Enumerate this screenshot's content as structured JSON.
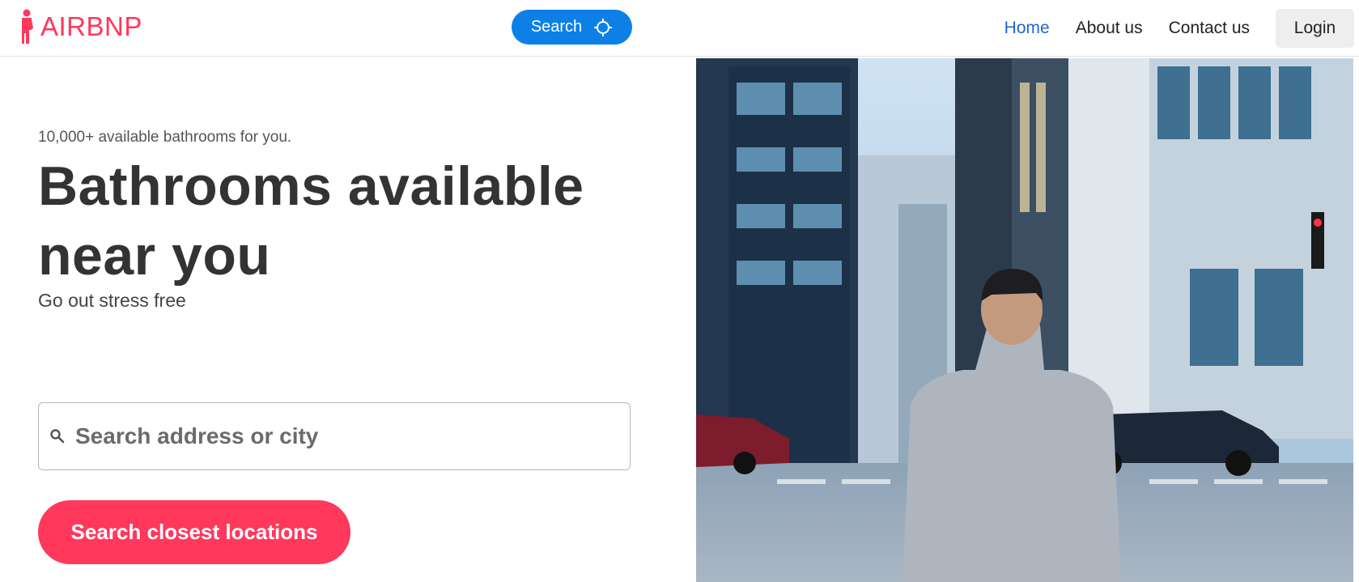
{
  "brand": {
    "name": "AIRBNP",
    "accent": "#ff385c"
  },
  "nav": {
    "search_label": "Search",
    "links": [
      {
        "label": "Home",
        "active": true
      },
      {
        "label": "About us",
        "active": false
      },
      {
        "label": "Contact us",
        "active": false
      }
    ],
    "login_label": "Login",
    "search_color": "#0d80e8"
  },
  "hero": {
    "tagline": "10,000+ available bathrooms for you.",
    "headline": "Bathrooms available near you",
    "subline": "Go out stress free",
    "search_placeholder": "Search address or city",
    "cta_label": "Search closest locations",
    "image_icon": "city-street-photo"
  }
}
